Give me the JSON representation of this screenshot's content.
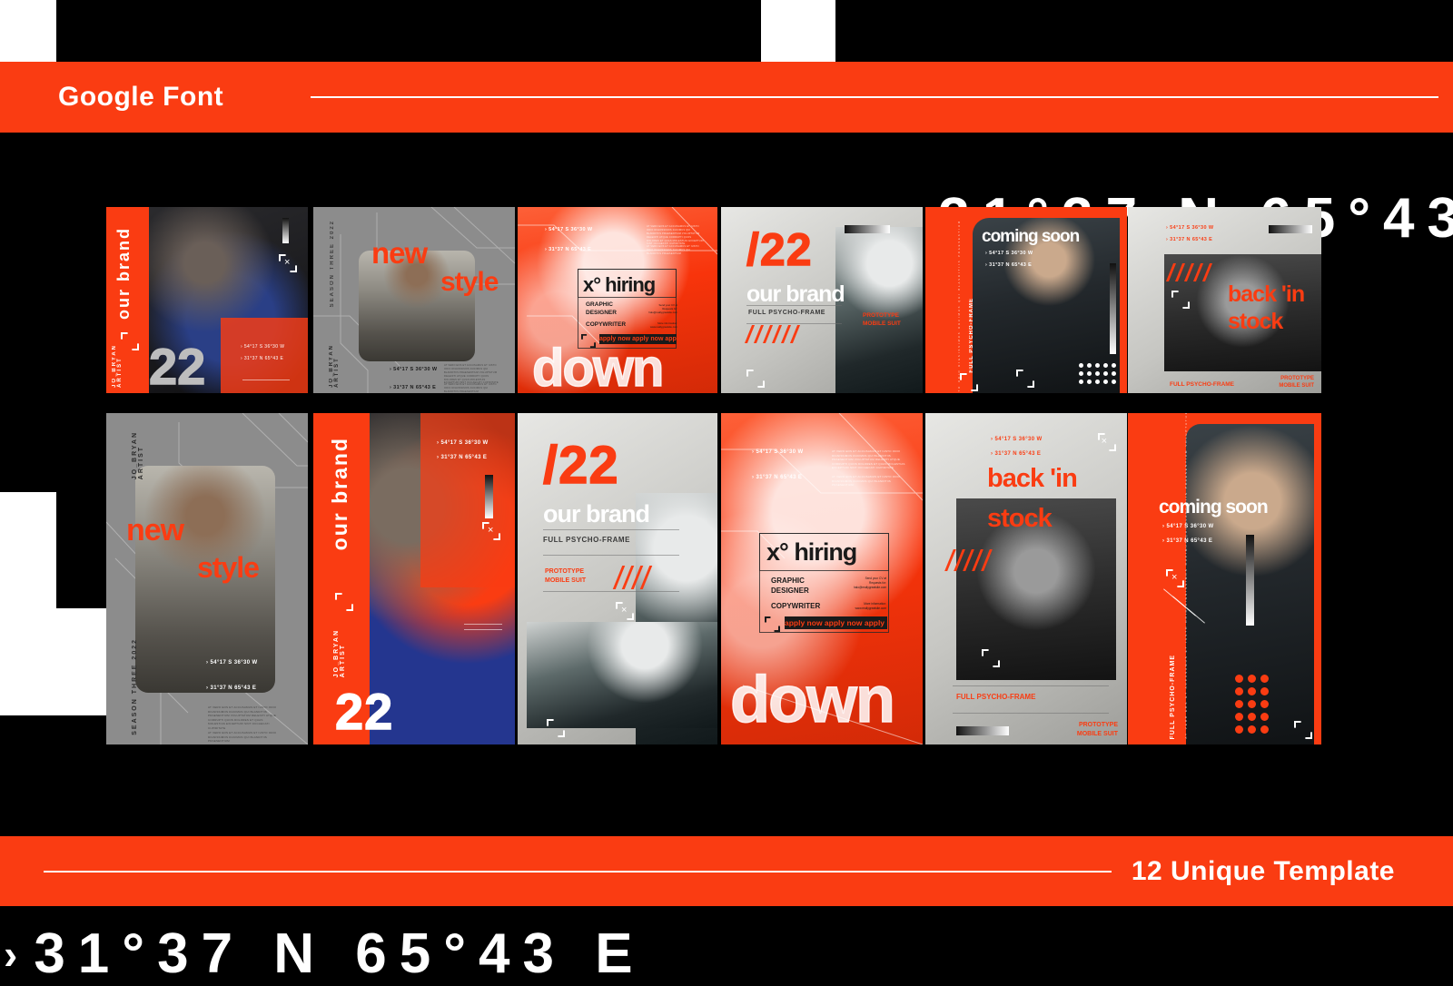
{
  "page": {
    "background": "#000000",
    "accent": "#fa3c12"
  },
  "header_bar": {
    "title": "Google Font"
  },
  "footer_bar": {
    "title": "12 Unique Template"
  },
  "background_text": {
    "top_coordinate": "31°37 N  65°43",
    "bottom_coordinate": "31°37 N  65°43 E",
    "chevron": "›"
  },
  "common": {
    "coord_1": "› 54°17 S  36°30 W",
    "coord_2": "› 31°37 N  65°43 E",
    "lorem": "AT VERO EOS ET ACCUSAMUS ET IUSTO ODIO DIGNISSIMOS DUCIMUS QUI BLANDITIIS PRAESENTIUM VOLUPTATUM DELENITI ATQUE CORRUPTI QUOS DOLORES ET QUAS MOLESTIAS EXCEPTURI SINT OCCAECATI CUPIDITATE",
    "lorem_short": "AT VERO EOS ET ACCUSAMUS ET IUSTO ODIO DIGNISSIMOS DUCIMUS QUI BLANDITIIS PRAESENTIUM"
  },
  "cards": [
    {
      "id": "card-our-brand-portrait",
      "row": 1,
      "col": 1,
      "theme": "orange-photo",
      "vertical_title": "our brand",
      "vertical_credit": "JO_BRYAN\nARTIST",
      "number": "22",
      "coords": [
        "› 54°17 S  36°30 W",
        "› 31°37 N  65°43 E"
      ]
    },
    {
      "id": "card-new-style-square",
      "row": 1,
      "col": 2,
      "theme": "gray",
      "headline_1": "new",
      "headline_2": "style",
      "vertical_season": "SEASON THREE 2022",
      "vertical_credit": "JO_BRYAN\nARTIST",
      "coords": [
        "› 54°17 S  36°30 W",
        "› 31°37 N  65°43 E"
      ]
    },
    {
      "id": "card-hiring-square",
      "row": 1,
      "col": 3,
      "theme": "orange",
      "headline": "x° hiring",
      "role_1": "GRAPHIC\nDESIGNER",
      "role_2": "COPYWRITER",
      "marquee": "apply now  apply now  apply now  apply",
      "contact_1": "Send your CV at\nRequests for:\nhalo@reallygreatsite.com",
      "contact_2": "More information:\nwww.reallygreatsite.com",
      "outline_word": "down",
      "coords": [
        "› 54°17 S  36°30 W",
        "› 31°37 N  65°43 E"
      ]
    },
    {
      "id": "card-our-brand-22-square",
      "row": 1,
      "col": 4,
      "theme": "light-gray",
      "outline_number": "/22",
      "headline": "our brand",
      "subtitle": "FULL PSYCHO-FRAME",
      "tag": "PROTOTYPE\nMOBILE SUIT"
    },
    {
      "id": "card-coming-soon-square",
      "row": 1,
      "col": 5,
      "theme": "orange",
      "headline": "coming soon",
      "vertical_tag": "FULL PSYCHO-FRAME",
      "coords": [
        "› 54°17 S  36°30 W",
        "› 31°37 N  65°43 E"
      ]
    },
    {
      "id": "card-back-in-stock-square",
      "row": 1,
      "col": 6,
      "theme": "light-gray",
      "headline_1": "back 'in",
      "headline_2": "stock",
      "subtitle": "FULL PSYCHO-FRAME",
      "tag": "PROTOTYPE\nMOBILE SUIT",
      "coords": [
        "› 54°17 S  36°30 W",
        "› 31°37 N  65°43 E"
      ]
    },
    {
      "id": "card-new-style-story",
      "row": 2,
      "col": 1,
      "theme": "gray",
      "headline_1": "new",
      "headline_2": "style",
      "vertical_credit": "JO_BRYAN\nARTIST",
      "vertical_season": "SEASON THREE 2022",
      "coords": [
        "› 54°17 S  36°30 W",
        "› 31°37 N  65°43 E"
      ]
    },
    {
      "id": "card-our-brand-story",
      "row": 2,
      "col": 2,
      "theme": "orange-photo",
      "vertical_title": "our brand",
      "vertical_credit": "JO_BRYAN\nARTIST",
      "number": "22",
      "coords": [
        "› 54°17 S  36°30 W",
        "› 31°37 N  65°43 E"
      ]
    },
    {
      "id": "card-our-brand-22-story",
      "row": 2,
      "col": 3,
      "theme": "light-gray",
      "outline_number": "/22",
      "headline": "our brand",
      "subtitle": "FULL PSYCHO-FRAME",
      "tag": "PROTOTYPE\nMOBILE SUIT"
    },
    {
      "id": "card-hiring-story",
      "row": 2,
      "col": 4,
      "theme": "orange",
      "headline": "x° hiring",
      "role_1": "GRAPHIC\nDESIGNER",
      "role_2": "COPYWRITER",
      "marquee": "apply now  apply now  apply now  apply",
      "contact_1": "Send your CV at\nRequests for:\nhalo@reallygreatsite.com",
      "contact_2": "More information:\nwww.reallygreatsite.com",
      "outline_word": "down",
      "coords": [
        "› 54°17 S  36°30 W",
        "› 31°37 N  65°43 E"
      ]
    },
    {
      "id": "card-back-in-stock-story",
      "row": 2,
      "col": 5,
      "theme": "light-gray",
      "headline_1": "back 'in",
      "headline_2": "stock",
      "subtitle": "FULL PSYCHO-FRAME",
      "tag": "PROTOTYPE\nMOBILE SUIT",
      "coords": [
        "› 54°17 S  36°30 W",
        "› 31°37 N  65°43 E"
      ]
    },
    {
      "id": "card-coming-soon-story",
      "row": 2,
      "col": 6,
      "theme": "orange",
      "headline": "coming soon",
      "vertical_tag": "FULL PSYCHO-FRAME",
      "coords": [
        "› 54°17 S  36°30 W",
        "› 31°37 N  65°43 E"
      ]
    }
  ]
}
